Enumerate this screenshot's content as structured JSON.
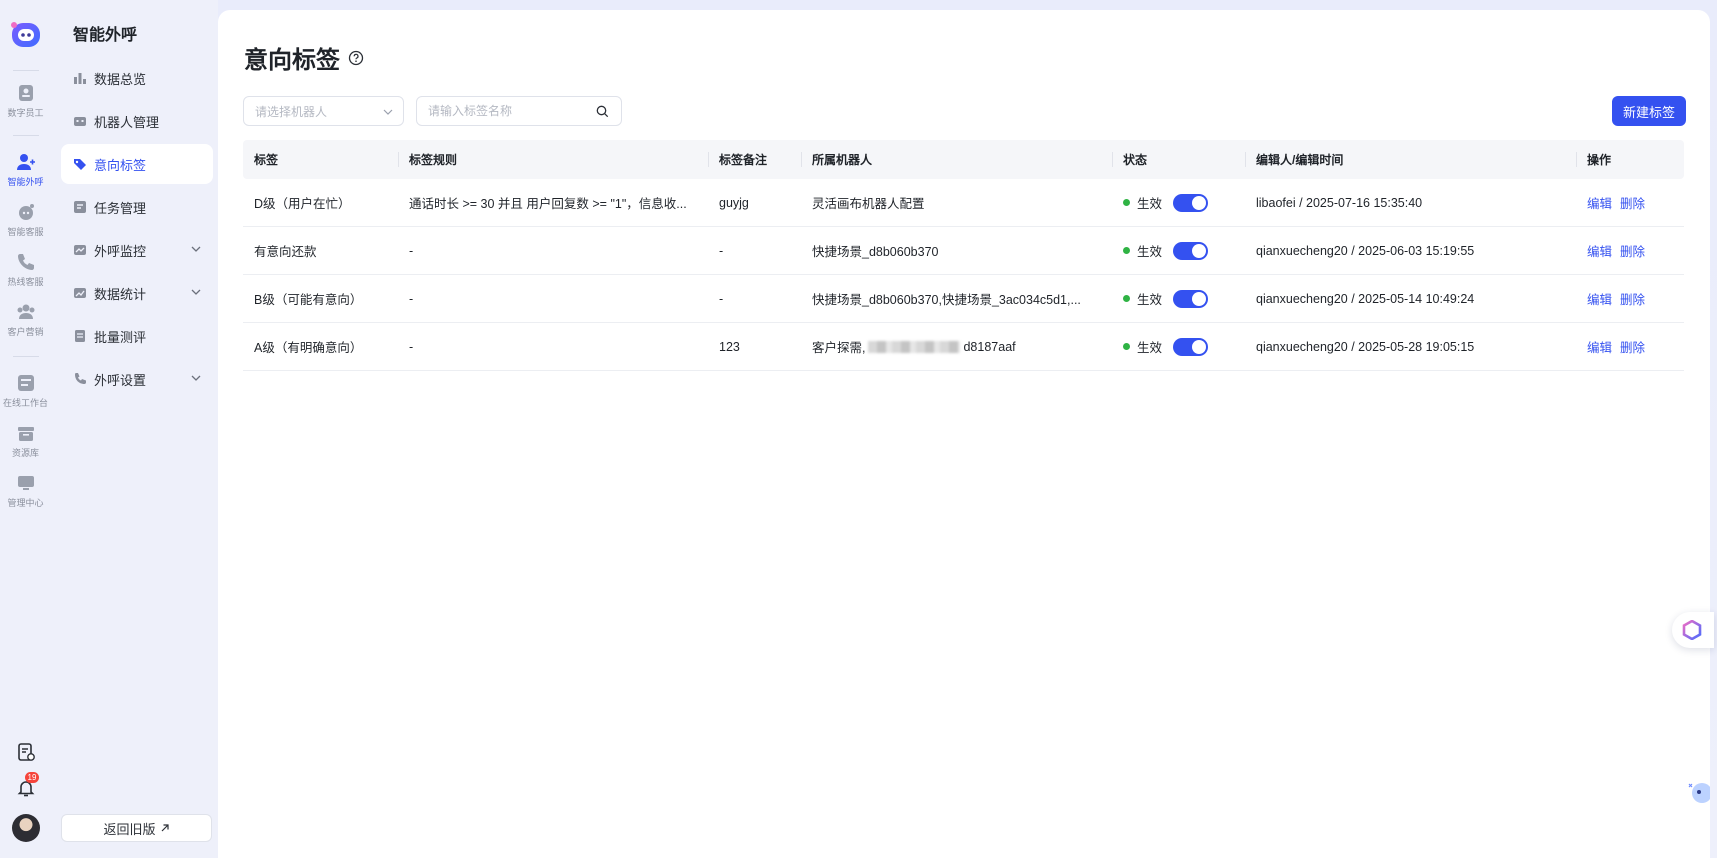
{
  "rail": {
    "items": [
      {
        "label": "数字员工",
        "icon": "digital-employee-icon"
      },
      {
        "label": "智能外呼",
        "icon": "smart-call-icon",
        "active": true
      },
      {
        "label": "智能客服",
        "icon": "chatbot-icon"
      },
      {
        "label": "热线客服",
        "icon": "phone-icon"
      },
      {
        "label": "客户营销",
        "icon": "users-icon"
      },
      {
        "label": "在线工作台",
        "icon": "workbench-icon"
      },
      {
        "label": "资源库",
        "icon": "resource-box-icon"
      },
      {
        "label": "管理中心",
        "icon": "monitor-icon"
      }
    ],
    "notification_count": "19"
  },
  "sidebar": {
    "title": "智能外呼",
    "items": [
      {
        "label": "数据总览"
      },
      {
        "label": "机器人管理"
      },
      {
        "label": "意向标签",
        "active": true
      },
      {
        "label": "任务管理"
      },
      {
        "label": "外呼监控"
      },
      {
        "label": "数据统计"
      },
      {
        "label": "批量测评"
      },
      {
        "label": "外呼设置"
      }
    ],
    "old_version_label": "返回旧版"
  },
  "page": {
    "title": "意向标签",
    "robot_select_placeholder": "请选择机器人",
    "search_placeholder": "请输入标签名称",
    "new_button": "新建标签"
  },
  "table": {
    "headers": [
      "标签",
      "标签规则",
      "标签备注",
      "所属机器人",
      "状态",
      "编辑人/编辑时间",
      "操作"
    ],
    "rows": [
      {
        "tag": "D级（用户在忙）",
        "rule": "通话时长 >= 30 并且 用户回复数 >= \"1\"，信息收...",
        "note": "guyjg",
        "robot": "灵活画布机器人配置",
        "status": "生效",
        "editor": "libaofei / 2025-07-16 15:35:40",
        "edit": "编辑",
        "delete": "删除"
      },
      {
        "tag": "有意向还款",
        "rule": "-",
        "note": "-",
        "robot": "快捷场景_d8b060b370",
        "status": "生效",
        "editor": "qianxuecheng20 / 2025-06-03 15:19:55",
        "edit": "编辑",
        "delete": "删除"
      },
      {
        "tag": "B级（可能有意向）",
        "rule": "-",
        "note": "-",
        "robot": "快捷场景_d8b060b370,快捷场景_3ac034c5d1,...",
        "status": "生效",
        "editor": "qianxuecheng20 / 2025-05-14 10:49:24",
        "edit": "编辑",
        "delete": "删除"
      },
      {
        "tag": "A级（有明确意向）",
        "rule": "-",
        "note": "123",
        "robot_prefix": "客户探需,",
        "robot_suffix": "d8187aaf",
        "status": "生效",
        "editor": "qianxuecheng20 / 2025-05-28 19:05:15",
        "edit": "编辑",
        "delete": "删除"
      }
    ]
  },
  "colors": {
    "accent": "#3451f0",
    "active_dot": "#2fb344"
  }
}
